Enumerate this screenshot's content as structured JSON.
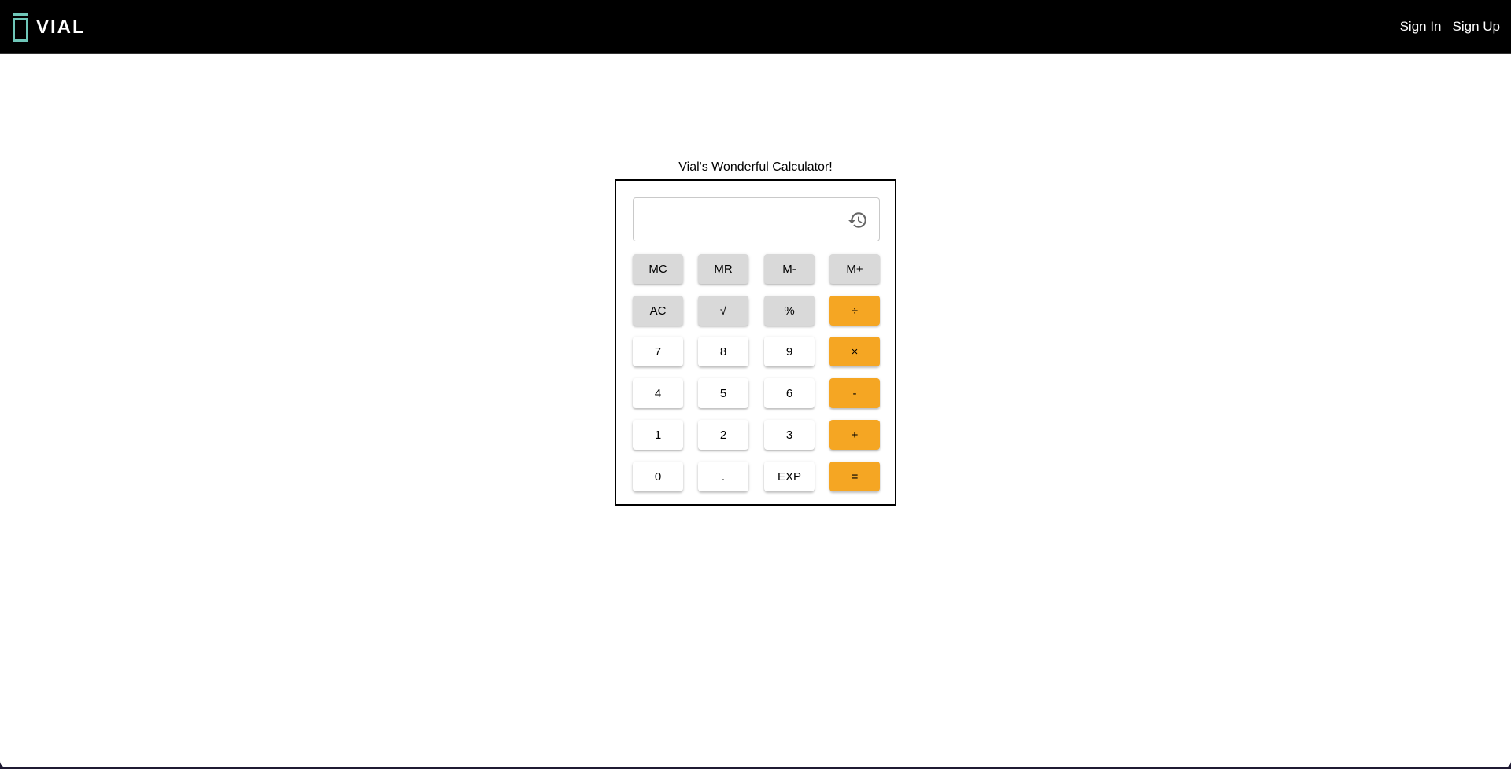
{
  "app": {
    "brand": "VIAL",
    "brand_color": "#6fc7b9",
    "nav_links": [
      "Sign In",
      "Sign Up"
    ]
  },
  "calculator": {
    "title": "Vial's Wonderful Calculator!",
    "display_value": "",
    "history_icon": "history-icon",
    "colors": {
      "memory_and_function_keys": "#d9d9d9",
      "digit_keys": "#ffffff",
      "operator_keys": "#f5a623"
    },
    "rows": [
      [
        {
          "label": "MC",
          "kind": "gray",
          "name": "memory-clear-button"
        },
        {
          "label": "MR",
          "kind": "gray",
          "name": "memory-recall-button"
        },
        {
          "label": "M-",
          "kind": "gray",
          "name": "memory-subtract-button"
        },
        {
          "label": "M+",
          "kind": "gray",
          "name": "memory-add-button"
        }
      ],
      [
        {
          "label": "AC",
          "kind": "gray",
          "name": "all-clear-button"
        },
        {
          "label": "√",
          "kind": "gray",
          "name": "square-root-button"
        },
        {
          "label": "%",
          "kind": "gray",
          "name": "percent-button"
        },
        {
          "label": "÷",
          "kind": "orange",
          "name": "divide-button"
        }
      ],
      [
        {
          "label": "7",
          "kind": "white",
          "name": "digit-7-button"
        },
        {
          "label": "8",
          "kind": "white",
          "name": "digit-8-button"
        },
        {
          "label": "9",
          "kind": "white",
          "name": "digit-9-button"
        },
        {
          "label": "×",
          "kind": "orange",
          "name": "multiply-button"
        }
      ],
      [
        {
          "label": "4",
          "kind": "white",
          "name": "digit-4-button"
        },
        {
          "label": "5",
          "kind": "white",
          "name": "digit-5-button"
        },
        {
          "label": "6",
          "kind": "white",
          "name": "digit-6-button"
        },
        {
          "label": "-",
          "kind": "orange",
          "name": "subtract-button"
        }
      ],
      [
        {
          "label": "1",
          "kind": "white",
          "name": "digit-1-button"
        },
        {
          "label": "2",
          "kind": "white",
          "name": "digit-2-button"
        },
        {
          "label": "3",
          "kind": "white",
          "name": "digit-3-button"
        },
        {
          "label": "+",
          "kind": "orange",
          "name": "add-button"
        }
      ],
      [
        {
          "label": "0",
          "kind": "white",
          "name": "digit-0-button"
        },
        {
          "label": ".",
          "kind": "white",
          "name": "decimal-point-button"
        },
        {
          "label": "EXP",
          "kind": "white",
          "name": "exponent-button"
        },
        {
          "label": "=",
          "kind": "orange",
          "name": "equals-button"
        }
      ]
    ]
  }
}
